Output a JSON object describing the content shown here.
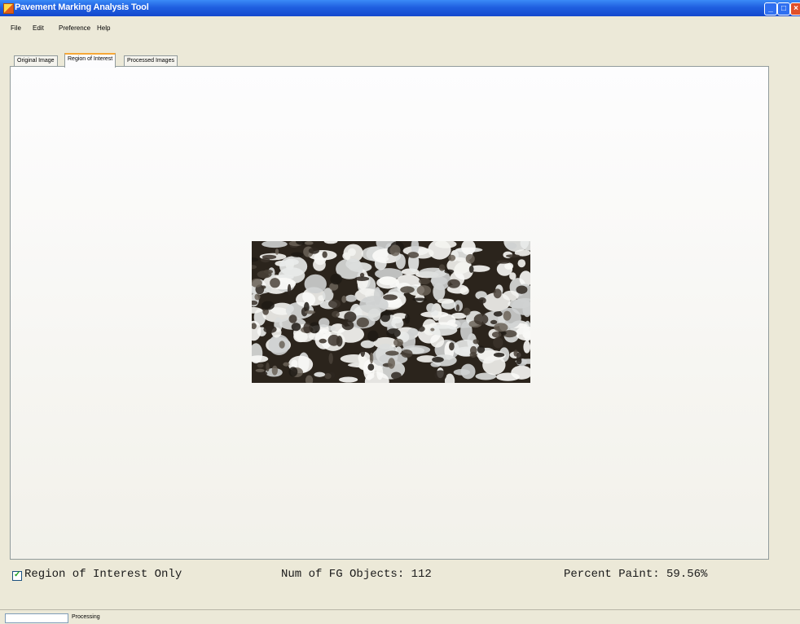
{
  "window": {
    "title": "Pavement Marking Analysis Tool",
    "icon": "app-icon",
    "controls": {
      "minimize": "_",
      "maximize": "□",
      "close": "×"
    }
  },
  "menu": {
    "items": [
      "File",
      "Edit",
      "Preference",
      "Help"
    ]
  },
  "tabs": [
    {
      "label": "Original Image",
      "active": false
    },
    {
      "label": "Region of Interest",
      "active": true
    },
    {
      "label": "Processed Images",
      "active": false
    }
  ],
  "roi": {
    "checkbox_label": "Region of Interest Only",
    "checked": true
  },
  "stats": {
    "fg_objects": "Num of FG Objects:  112",
    "percent_paint": "Percent Paint:  59.56%"
  },
  "status": {
    "text": "Processing"
  },
  "colors": {
    "titlebar": "#1f5fe0",
    "window_bg": "#ece9d8",
    "active_tab_accent": "#f6a838",
    "checkbox_mark": "#21a121"
  }
}
